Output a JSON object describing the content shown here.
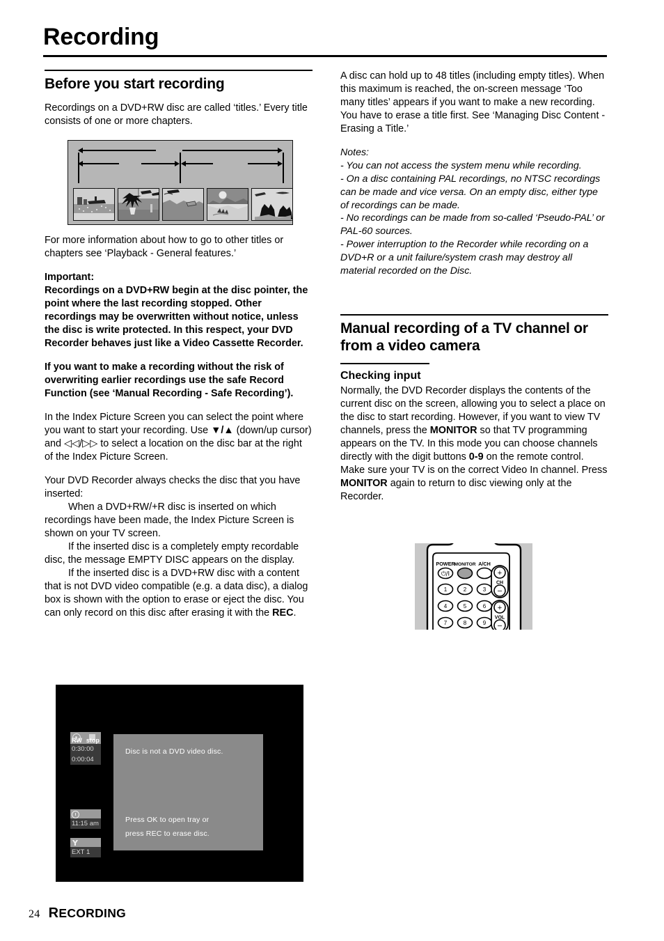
{
  "page": {
    "title": "Recording",
    "footer_number": "24",
    "footer_label_cap": "R",
    "footer_label_rest": "ECORDING"
  },
  "left_column": {
    "section_heading": "Before you start recording",
    "intro": "Recordings on a DVD+RW disc are called ‘titles.’ Every title consists of one or more chapters.",
    "after_diagram": "For more information about how to go to other titles or chapters see ‘Playback - General features.’",
    "important_label": "Important:",
    "important_text": "Recordings on a DVD+RW begin at the disc pointer, the point where the last recording stopped. Other recordings may be overwritten without notice, unless the disc is write protected. In this respect, your DVD Recorder behaves just like a Video Cassette Recorder.",
    "safe_record_text": "If you want to make a recording without the risk of overwriting earlier recordings use the safe Record Function (see ‘Manual Recording - Safe Recording’).",
    "index_picture_text_a": "In the Index Picture Screen you can select the point where you want to start your recording. Use ",
    "index_cursor_symbols_1": "▼/▲",
    "index_picture_text_b": " (down/up cursor) and ",
    "index_cursor_symbols_2": "◁◁/▷▷",
    "index_picture_text_c": " to select a location on the disc bar at the right of the Index Picture Screen.",
    "checks_intro": "Your DVD Recorder always checks the disc that you have inserted:",
    "check_item_1": "When a DVD+RW/+R disc is inserted on which recordings have been made, the Index Picture Screen is shown on your TV screen.",
    "check_item_2": "If the inserted disc is a completely empty recordable disc, the message EMPTY DISC appears on the display.",
    "check_item_3_a": "If the inserted disc is a DVD+RW disc with a content that is not DVD video compatible (e.g. a data disc), a dialog box is shown with the option to erase or eject the disc. You can only record on this disc after erasing it with the ",
    "check_item_3_bold": "REC",
    "check_item_3_b": "."
  },
  "right_column": {
    "capacity_text": "A disc can hold up to 48 titles (including empty titles). When this maximum is reached, the on-screen message ‘Too many titles’ appears if you want to make a new recording. You have to erase a title first. See ‘Managing Disc Content - Erasing a Title.’",
    "notes_label": "Notes:",
    "notes": [
      "- You can not access the system menu while recording.",
      "- On a disc containing PAL recordings, no NTSC recordings can be made and vice versa. On an empty disc, either type of recordings can be made.",
      "- No recordings can be made from so-called ‘Pseudo-PAL’ or PAL-60 sources.",
      "- Power interruption to the Recorder while recording on a DVD+R or a unit failure/system crash may destroy all material recorded on the Disc."
    ],
    "section_heading": "Manual recording of a TV channel or from a video camera",
    "sub_heading": "Checking input",
    "checking_text_a": "Normally, the DVD Recorder displays the contents of the current disc on the screen, allowing you to select a place on the disc to start recording. However, if you want to view TV channels, press the ",
    "monitor_1": "MONITOR",
    "checking_text_b": " so that TV programming appears on the TV. In this mode you can choose channels directly with the digit buttons ",
    "digits_0_9": "0-9",
    "checking_text_c": " on the remote control.",
    "checking_text_d": "Make sure your TV is on the correct Video In channel. Press ",
    "monitor_2": "MONITOR",
    "checking_text_e": " again to return to disc viewing only at the Recorder."
  },
  "diagram": {
    "caption_role": "title-and-chapter-structure",
    "thumbnail_count": 5
  },
  "osd_screen": {
    "disc_type": "RW",
    "transport_state": "stop",
    "total_time": "0:30:00",
    "elapsed_time": "0:00:04",
    "clock": "11:15 am",
    "input_source": "EXT 1",
    "dialog_title": "Disc is not a DVD video disc.",
    "dialog_line_1": "Press OK to open tray or",
    "dialog_line_2": "press REC to erase disc."
  },
  "remote": {
    "power_label": "POWER",
    "power_symbol": "⏻/I",
    "monitor_label": "MONITOR",
    "ach_label": "A/CH",
    "digits": [
      "1",
      "2",
      "3",
      "4",
      "5",
      "6",
      "7",
      "8",
      "9"
    ],
    "ch_label": "CH",
    "vol_label": "VOL",
    "plus": "+",
    "minus": "–"
  },
  "colors": {
    "page_background": "#ffffff",
    "text": "#000000",
    "diagram_background": "#b6b6b6",
    "osd_frame": "#000000",
    "osd_dialog": "#8a8a8a",
    "remote_background": "#c8c8c8"
  }
}
